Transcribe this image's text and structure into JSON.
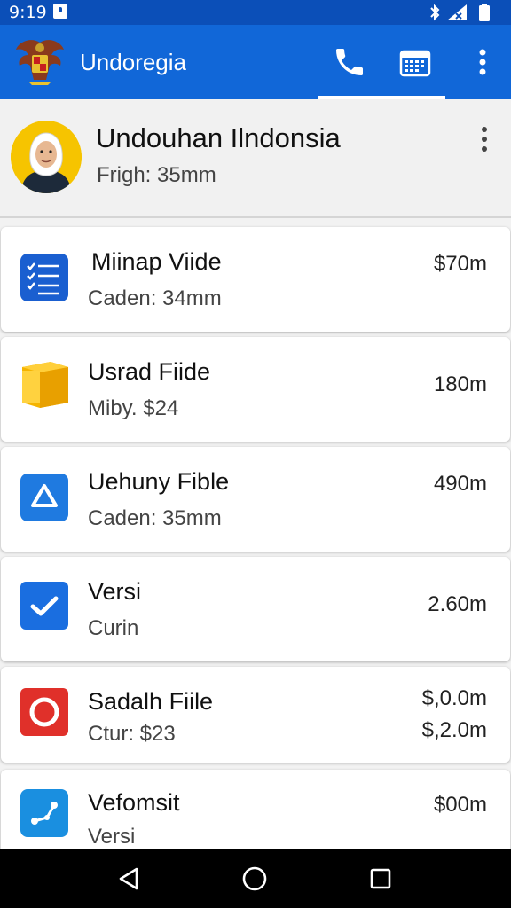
{
  "status_bar": {
    "time": "9:19"
  },
  "app_bar": {
    "title": "Undoregia"
  },
  "profile": {
    "name": "Undouhan Ilndonsia",
    "subtitle": "Frigh: 35mm"
  },
  "items": [
    {
      "title": "Miinap Viide",
      "subtitle": "Caden: 34mm",
      "value": "$70m",
      "value2": "",
      "icon": "checklist-icon",
      "color": "#1a5fd0"
    },
    {
      "title": "Usrad Fiide",
      "subtitle": "Miby. $24",
      "value": "180m",
      "value2": "",
      "icon": "folder-cube-icon",
      "color": "#f5b400"
    },
    {
      "title": "Uehuny Fible",
      "subtitle": "Caden: 35mm",
      "value": "490m",
      "value2": "",
      "icon": "triangle-icon",
      "color": "#1f7ae0"
    },
    {
      "title": "Versi",
      "subtitle": "Curin",
      "value": "2.60m",
      "value2": "",
      "icon": "check-icon",
      "color": "#1a6ee0"
    },
    {
      "title": "Sadalh Fiile",
      "subtitle": "Ctur: $23",
      "value": "$,0.0m",
      "value2": "$,2.0m",
      "icon": "record-circle-icon",
      "color": "#e0302a"
    },
    {
      "title": "Vefomsit",
      "subtitle": "Versi",
      "value": "$00m",
      "value2": "",
      "icon": "share-nodes-icon",
      "color": "#1a8fe0"
    }
  ],
  "colors": {
    "app_bar": "#1167d8",
    "status_bar": "#0b4fb8"
  }
}
